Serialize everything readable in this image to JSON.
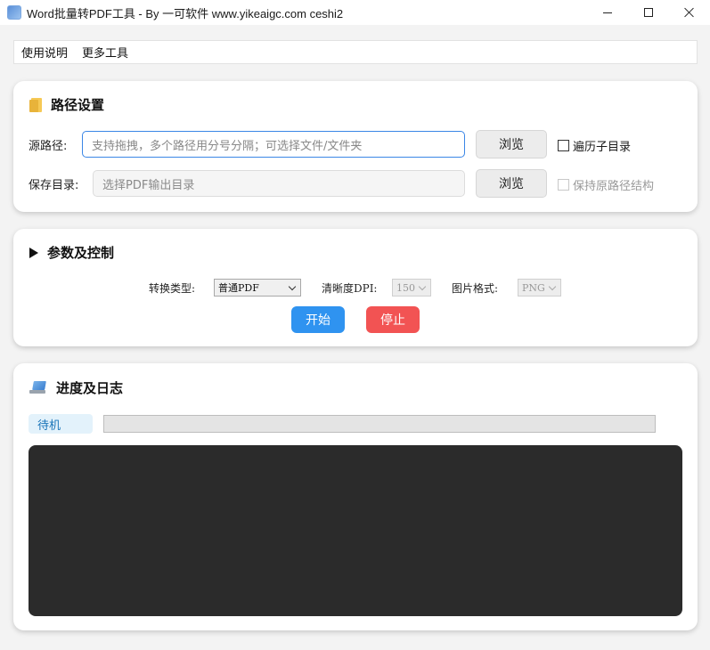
{
  "window": {
    "title": "Word批量转PDF工具 - By 一可软件 www.yikeaigc.com ceshi2"
  },
  "menu": {
    "items": [
      "使用说明",
      "更多工具"
    ]
  },
  "path_settings": {
    "title": "路径设置",
    "source_label": "源路径:",
    "source_placeholder": "支持拖拽，多个路径用分号分隔；可选择文件/文件夹",
    "browse_label": "浏览",
    "recurse_label": "遍历子目录",
    "save_label": "保存目录:",
    "save_placeholder": "选择PDF输出目录",
    "keep_structure_label": "保持原路径结构"
  },
  "params": {
    "title": "参数及控制",
    "convert_type_label": "转换类型:",
    "convert_type_value": "普通PDF",
    "dpi_label": "清晰度DPI:",
    "dpi_value": "150",
    "image_format_label": "图片格式:",
    "image_format_value": "PNG",
    "start_label": "开始",
    "stop_label": "停止"
  },
  "progress": {
    "title": "进度及日志",
    "status": "待机",
    "percent": 0
  },
  "colors": {
    "start_button": "#2f93f0",
    "stop_button": "#f25353",
    "log_background": "#2b2b2b",
    "status_text": "#1773b8"
  }
}
